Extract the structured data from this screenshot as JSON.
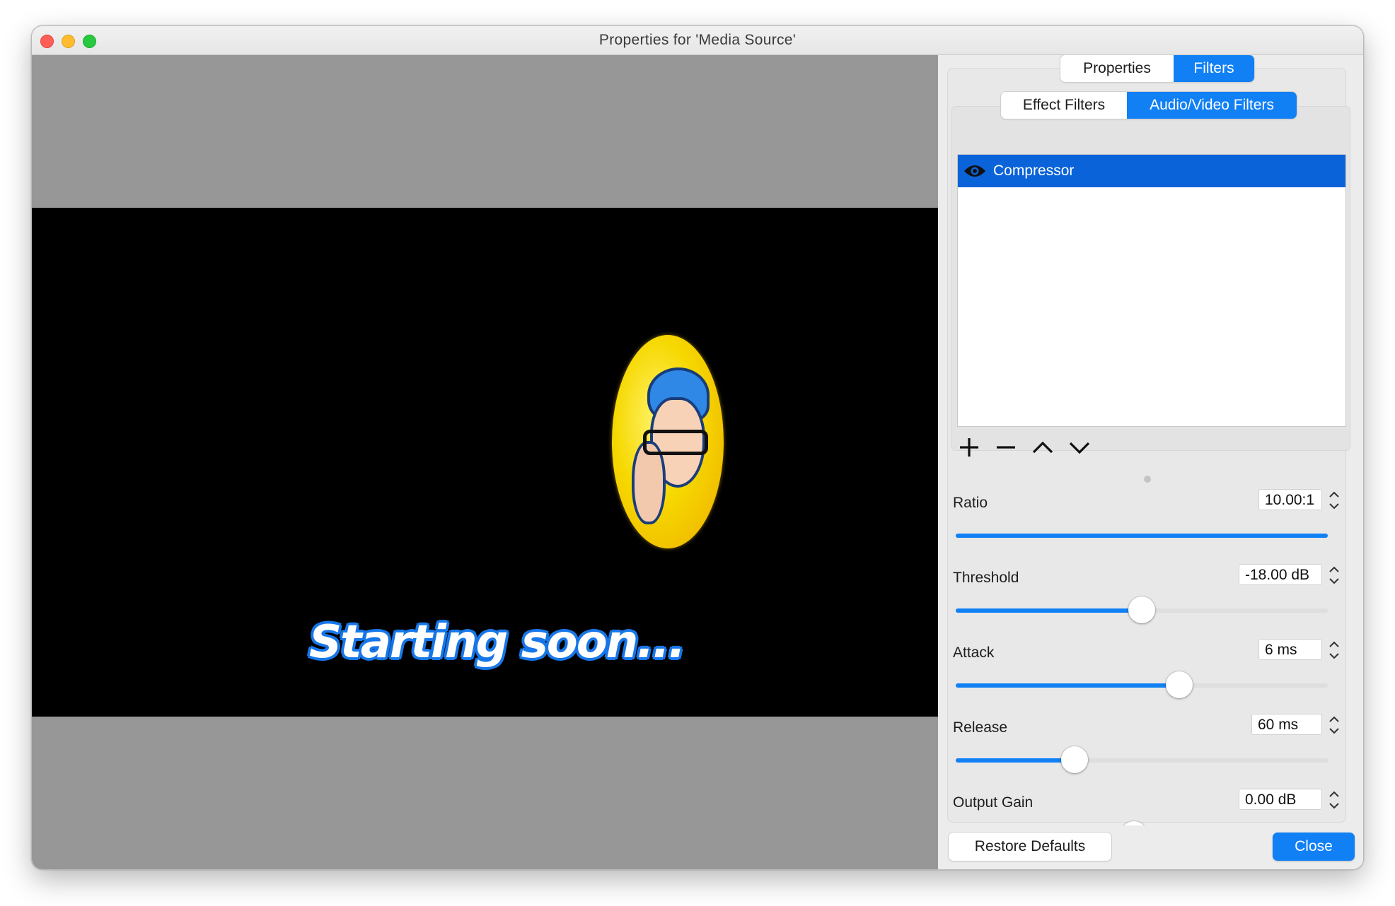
{
  "window": {
    "title": "Properties for 'Media Source'"
  },
  "preview": {
    "overlay_text": "Starting soon..."
  },
  "tabs": {
    "top": [
      "Properties",
      "Filters"
    ],
    "top_active": 1,
    "inner": [
      "Effect Filters",
      "Audio/Video Filters"
    ],
    "inner_active": 1
  },
  "filters": {
    "items": [
      {
        "label": "Compressor",
        "icon": "eye-icon",
        "selected": true
      }
    ]
  },
  "list_tools": [
    "plus-icon",
    "minus-icon",
    "chevron-up-icon",
    "chevron-down-icon"
  ],
  "properties": [
    {
      "label": "Ratio",
      "value": "10.00:1",
      "level": 1.0
    },
    {
      "label": "Threshold",
      "value": "-18.00 dB",
      "level": 0.5
    },
    {
      "label": "Attack",
      "value": "6 ms",
      "level": 0.6
    },
    {
      "label": "Release",
      "value": "60 ms",
      "level": 0.32
    },
    {
      "label": "Output Gain",
      "value": "0.00 dB",
      "level": 0.48
    }
  ],
  "buttons": {
    "restore": "Restore Defaults",
    "close": "Close"
  },
  "colors": {
    "accent": "#1180f5",
    "selection": "#0a63d8",
    "preview_bg": "#979797"
  }
}
